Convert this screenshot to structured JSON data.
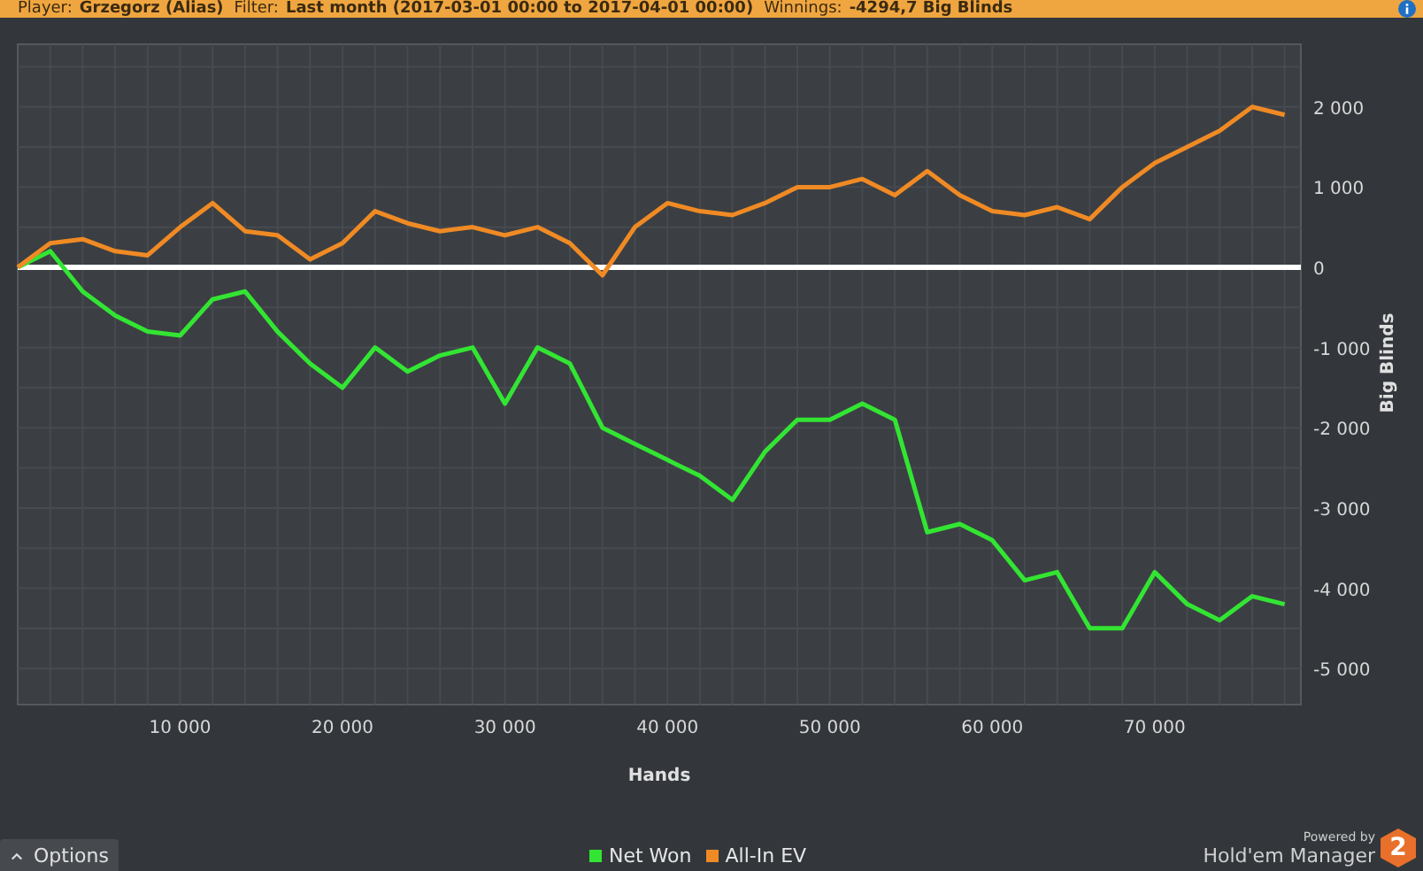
{
  "header": {
    "player_label": "Player:",
    "player": "Grzegorz (Alias)",
    "filter_label": "Filter:",
    "filter": "Last month (2017-03-01 00:00 to 2017-04-01 00:00)",
    "winnings_label": "Winnings:",
    "winnings": "-4294,7 Big Blinds"
  },
  "chart": {
    "chart_data": {
      "type": "line",
      "xlabel": "Hands",
      "ylabel": "Big Blinds",
      "grid": true,
      "xlim": [
        0,
        79000
      ],
      "ylim": [
        -5450,
        2780
      ],
      "xticks": [
        {
          "value": 10000,
          "label": "10 000"
        },
        {
          "value": 20000,
          "label": "20 000"
        },
        {
          "value": 30000,
          "label": "30 000"
        },
        {
          "value": 40000,
          "label": "40 000"
        },
        {
          "value": 50000,
          "label": "50 000"
        },
        {
          "value": 60000,
          "label": "60 000"
        },
        {
          "value": 70000,
          "label": "70 000"
        }
      ],
      "yticks": [
        {
          "value": 2000,
          "label": "2 000"
        },
        {
          "value": 1000,
          "label": "1 000"
        },
        {
          "value": 0,
          "label": "0"
        },
        {
          "value": -1000,
          "label": "-1 000"
        },
        {
          "value": -2000,
          "label": "-2 000"
        },
        {
          "value": -3000,
          "label": "-3 000"
        },
        {
          "value": -4000,
          "label": "-4 000"
        },
        {
          "value": -5000,
          "label": "-5 000"
        }
      ],
      "x": [
        0,
        2000,
        4000,
        6000,
        8000,
        10000,
        12000,
        14000,
        16000,
        18000,
        20000,
        22000,
        24000,
        26000,
        28000,
        30000,
        32000,
        34000,
        36000,
        38000,
        40000,
        42000,
        44000,
        46000,
        48000,
        50000,
        52000,
        54000,
        56000,
        58000,
        60000,
        62000,
        64000,
        66000,
        68000,
        70000,
        72000,
        74000,
        76000,
        78000
      ],
      "series": [
        {
          "name": "Net Won",
          "color": "#33e533",
          "values": [
            0,
            200,
            -300,
            -600,
            -800,
            -850,
            -400,
            -300,
            -800,
            -1200,
            -1500,
            -1000,
            -1300,
            -1100,
            -1000,
            -1700,
            -1000,
            -1200,
            -2000,
            -2200,
            -2400,
            -2600,
            -2900,
            -2300,
            -1900,
            -1900,
            -1700,
            -1900,
            -3300,
            -3200,
            -3400,
            -3900,
            -3800,
            -4500,
            -4500,
            -3800,
            -4200,
            -4400,
            -4100,
            -4200
          ]
        },
        {
          "name": "All-In EV",
          "color": "#f08a24",
          "values": [
            0,
            300,
            350,
            200,
            150,
            500,
            800,
            450,
            400,
            100,
            300,
            700,
            550,
            450,
            500,
            400,
            500,
            300,
            -100,
            500,
            800,
            700,
            650,
            800,
            1000,
            1000,
            1100,
            900,
            1200,
            900,
            700,
            650,
            750,
            600,
            1000,
            1300,
            1500,
            1700,
            2000,
            1900
          ]
        }
      ]
    }
  },
  "options_button": "Options",
  "branding": {
    "powered_by": "Powered by",
    "product": "Hold'em Manager",
    "badge": "2"
  }
}
